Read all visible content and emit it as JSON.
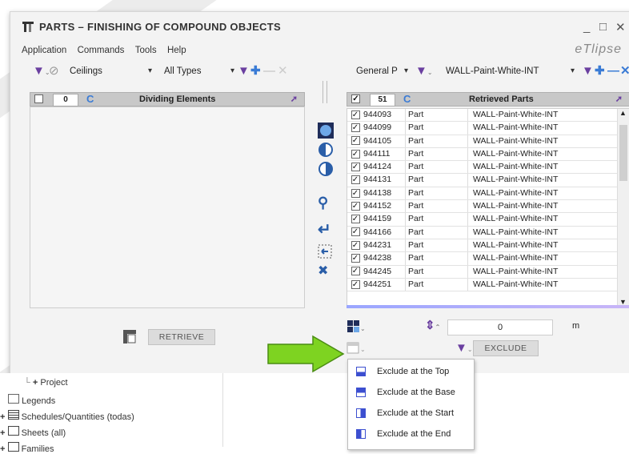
{
  "window": {
    "title": "PARTS – FINISHING OF COMPOUND OBJECTS",
    "brand": "eTlipse",
    "controls": [
      "_",
      "□",
      "✕"
    ]
  },
  "menubar": [
    "Application",
    "Commands",
    "Tools",
    "Help"
  ],
  "left": {
    "category": "Ceilings",
    "type": "All Types",
    "count": "0",
    "header": "Dividing Elements",
    "retrieve_label": "RETRIEVE"
  },
  "right": {
    "group": "General P",
    "filter": "WALL-Paint-White-INT",
    "count": "51",
    "header": "Retrieved Parts",
    "rows": [
      {
        "id": "944093",
        "type": "Part",
        "name": "WALL-Paint-White-INT"
      },
      {
        "id": "944099",
        "type": "Part",
        "name": "WALL-Paint-White-INT"
      },
      {
        "id": "944105",
        "type": "Part",
        "name": "WALL-Paint-White-INT"
      },
      {
        "id": "944111",
        "type": "Part",
        "name": "WALL-Paint-White-INT"
      },
      {
        "id": "944124",
        "type": "Part",
        "name": "WALL-Paint-White-INT"
      },
      {
        "id": "944131",
        "type": "Part",
        "name": "WALL-Paint-White-INT"
      },
      {
        "id": "944138",
        "type": "Part",
        "name": "WALL-Paint-White-INT"
      },
      {
        "id": "944152",
        "type": "Part",
        "name": "WALL-Paint-White-INT"
      },
      {
        "id": "944159",
        "type": "Part",
        "name": "WALL-Paint-White-INT"
      },
      {
        "id": "944166",
        "type": "Part",
        "name": "WALL-Paint-White-INT"
      },
      {
        "id": "944231",
        "type": "Part",
        "name": "WALL-Paint-White-INT"
      },
      {
        "id": "944238",
        "type": "Part",
        "name": "WALL-Paint-White-INT"
      },
      {
        "id": "944245",
        "type": "Part",
        "name": "WALL-Paint-White-INT"
      },
      {
        "id": "944251",
        "type": "Part",
        "name": "WALL-Paint-White-INT"
      }
    ],
    "offset_value": "0",
    "offset_unit": "m",
    "exclude_label": "EXCLUDE"
  },
  "dropdown_menu": [
    {
      "label": "Exclude at the Top",
      "icon": "exclude-top-icon"
    },
    {
      "label": "Exclude at the Base",
      "icon": "exclude-base-icon"
    },
    {
      "label": "Exclude at the Start",
      "icon": "exclude-start-icon"
    },
    {
      "label": "Exclude at the End",
      "icon": "exclude-end-icon"
    }
  ],
  "project_tree": [
    {
      "label": "Project",
      "icon": "plus-icon"
    },
    {
      "label": "Legends",
      "icon": "legends-icon"
    },
    {
      "label": "Schedules/Quantities (todas)",
      "icon": "schedule-icon"
    },
    {
      "label": "Sheets (all)",
      "icon": "sheet-icon"
    },
    {
      "label": "Families",
      "icon": "families-icon"
    }
  ],
  "colors": {
    "accent_blue": "#3a7bd5",
    "filter_purple": "#6a3fa0",
    "callout_green": "#7ed321",
    "menu_icon_blue": "#3c4fd0"
  }
}
